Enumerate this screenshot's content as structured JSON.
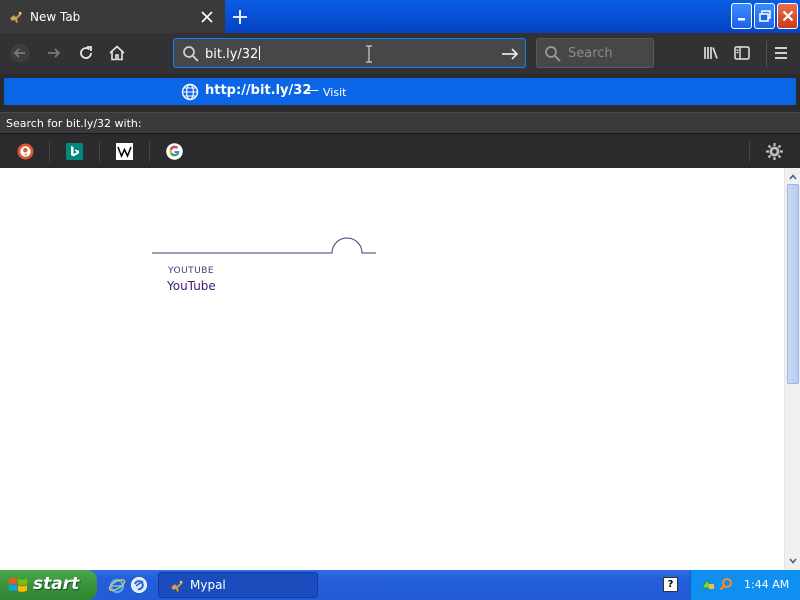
{
  "window": {
    "tab_title": "New Tab"
  },
  "navbar": {
    "url_value": "bit.ly/32",
    "search_placeholder": "Search"
  },
  "dropdown": {
    "suggestion_url": "http://bit.ly/32",
    "suggestion_dash": "—",
    "suggestion_action": "Visit",
    "search_with_label": "Search for bit.ly/32 with:",
    "engines": [
      "duckduckgo-icon",
      "bing-icon",
      "wikipedia-icon",
      "google-icon"
    ]
  },
  "page": {
    "tile_small": "YOUTUBE",
    "tile_title": "YouTube"
  },
  "taskbar": {
    "start_label": "start",
    "task_label": "Mypal",
    "clock": "1:44 AM",
    "help_label": "?"
  },
  "colors": {
    "accent": "#0a84ff",
    "suggestion_bg": "#0a66e6",
    "toolbar_bg": "#323234",
    "taskbar_bg": "#245edb",
    "start_green": "#3a933c"
  }
}
